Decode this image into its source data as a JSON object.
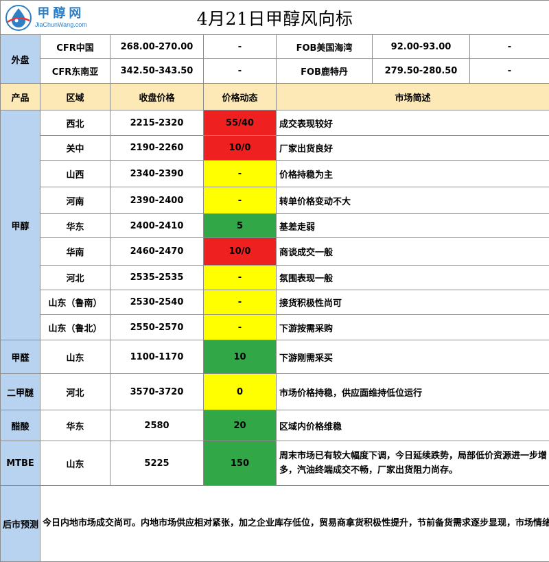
{
  "logo": {
    "name": "甲醇网",
    "url": "JiaChunWang.com"
  },
  "title": "4月21日甲醇风向标",
  "foreign_market": {
    "label": "外盘",
    "rows": [
      {
        "left_name": "CFR中国",
        "left_price": "268.00-270.00",
        "left_change": "-",
        "right_name": "FOB美国海湾",
        "right_price": "92.00-93.00",
        "right_change": "-"
      },
      {
        "left_name": "CFR东南亚",
        "left_price": "342.50-343.50",
        "left_change": "-",
        "right_name": "FOB鹿特丹",
        "right_price": "279.50-280.50",
        "right_change": "-"
      }
    ]
  },
  "headers": {
    "product": "产品",
    "region": "区域",
    "price": "收盘价格",
    "change": "价格动态",
    "desc": "市场简述"
  },
  "methanol": {
    "product": "甲醇",
    "rows": [
      {
        "region": "西北",
        "price": "2215-2320",
        "change": "55/40",
        "trend": "up",
        "desc": "成交表现较好"
      },
      {
        "region": "关中",
        "price": "2190-2260",
        "change": "10/0",
        "trend": "up",
        "desc": "厂家出货良好"
      },
      {
        "region": "山西",
        "price": "2340-2390",
        "change": "-",
        "trend": "flat",
        "desc": "价格持稳为主"
      },
      {
        "region": "河南",
        "price": "2390-2400",
        "change": "-",
        "trend": "flat",
        "desc": "转单价格变动不大"
      },
      {
        "region": "华东",
        "price": "2400-2410",
        "change": "5",
        "trend": "down",
        "desc": "基差走弱"
      },
      {
        "region": "华南",
        "price": "2460-2470",
        "change": "10/0",
        "trend": "up",
        "desc": "商谈成交一般"
      },
      {
        "region": "河北",
        "price": "2535-2535",
        "change": "-",
        "trend": "flat",
        "desc": "氛围表现一般"
      },
      {
        "region": "山东（鲁南）",
        "price": "2530-2540",
        "change": "-",
        "trend": "flat",
        "desc": "接货积极性尚可"
      },
      {
        "region": "山东（鲁北）",
        "price": "2550-2570",
        "change": "-",
        "trend": "flat",
        "desc": "下游按需采购"
      }
    ]
  },
  "others": [
    {
      "product": "甲醛",
      "region": "山东",
      "price": "1100-1170",
      "change": "10",
      "trend": "down",
      "desc": "下游刚需采买"
    },
    {
      "product": "二甲醚",
      "region": "河北",
      "price": "3570-3720",
      "change": "0",
      "trend": "flat",
      "desc": "市场价格持稳，供应面维持低位运行"
    },
    {
      "product": "醋酸",
      "region": "华东",
      "price": "2580",
      "change": "20",
      "trend": "down",
      "desc": "区域内价格维稳"
    },
    {
      "product": "MTBE",
      "region": "山东",
      "price": "5225",
      "change": "150",
      "trend": "down",
      "desc": "周末市场已有较大幅度下调，今日延续跌势，局部低价资源进一步增多，汽油终端成交不畅，厂家出货阻力尚存。"
    }
  ],
  "forecast": {
    "label": "后市预测",
    "text": "今日内地市场成交尚可。内地市场供应相对紧张，加之企业库存低位，贸易商拿货积极性提升，节前备货需求逐步显现，市场情绪明显好转，转单价格小幅上涨，部分企业竞拍成交价格同步推涨。目前看区域供应仍偏紧，部分烯烃存外采预期，叠加节前下游逐步开始备货，对市场存明显支撑。预计短期甲醇市场走势区间震荡。"
  },
  "colors": {
    "up": "#ee2020",
    "flat": "#ffff00",
    "down": "#31a748",
    "label_bg": "#b8d3ef",
    "header_bg": "#fde9b5"
  }
}
